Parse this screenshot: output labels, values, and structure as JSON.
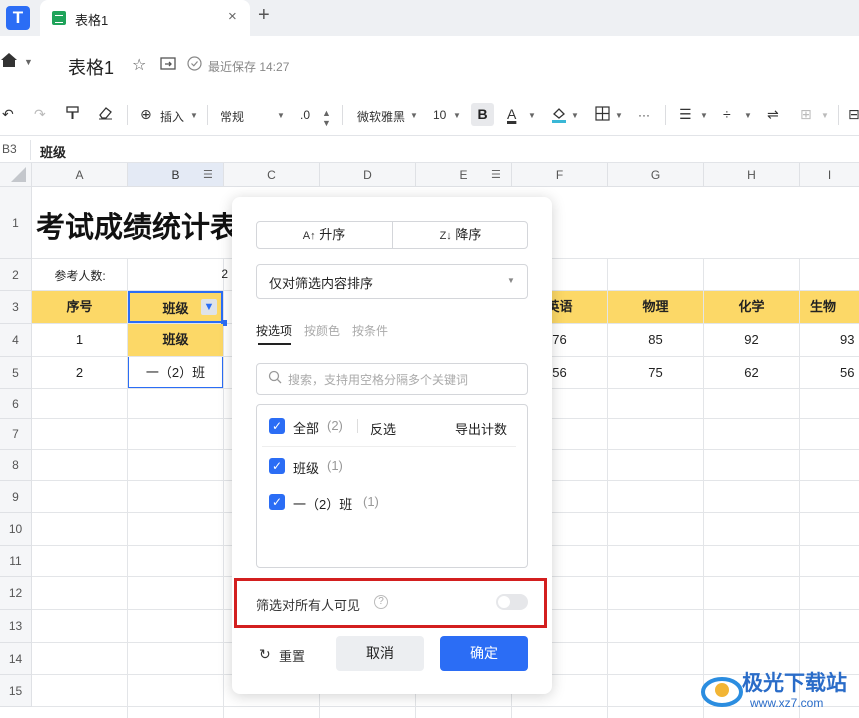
{
  "tab": {
    "title": "表格1",
    "close": "×",
    "add": "+"
  },
  "header": {
    "doc_title": "表格1",
    "saved": "最近保存 14:27"
  },
  "toolbar": {
    "insert": "插入",
    "format": "常规",
    "decimal": ".0",
    "font": "微软雅黑",
    "size": "10",
    "bold": "B",
    "fontcolor": "A",
    "more": "···"
  },
  "formula": {
    "cellref": "B3",
    "value": "班级"
  },
  "columns": [
    "A",
    "B",
    "C",
    "D",
    "E",
    "F",
    "G",
    "H",
    "I"
  ],
  "rows": [
    "1",
    "2",
    "3",
    "4",
    "5",
    "6",
    "7",
    "8",
    "9",
    "10",
    "11",
    "12",
    "13",
    "14",
    "15"
  ],
  "sheet": {
    "title": "考试成绩统计表",
    "participants_label": "参考人数:",
    "participants_value": "2",
    "headers": {
      "a": "序号",
      "b": "班级",
      "f": "英语",
      "g": "物理",
      "h": "化学",
      "i": "生物"
    },
    "row4": {
      "a": "1",
      "b": "班级",
      "f": "76",
      "g": "85",
      "h": "92",
      "i": "93"
    },
    "row5": {
      "a": "2",
      "b": "一（2）班",
      "f": "56",
      "g": "75",
      "h": "62",
      "i": "56"
    }
  },
  "filter": {
    "asc": "升序",
    "desc": "降序",
    "sort_select": "仅对筛选内容排序",
    "tabs": [
      "按选项",
      "按颜色",
      "按条件"
    ],
    "search_placeholder": "搜索，支持用空格分隔多个关键词",
    "all_label": "全部",
    "all_count": "(2)",
    "invert": "反选",
    "export": "导出计数",
    "items": [
      {
        "label": "班级",
        "count": "(1)"
      },
      {
        "label": "一（2）班",
        "count": "(1)"
      }
    ],
    "visible_label": "筛选对所有人可见",
    "visible_on": false,
    "reset": "重置",
    "cancel": "取消",
    "ok": "确定"
  },
  "watermark": {
    "name": "极光下载站",
    "url": "www.xz7.com"
  },
  "colors": {
    "accent": "#2b6df5",
    "header_yellow": "#fcd867",
    "highlight": "#d31f1f"
  }
}
